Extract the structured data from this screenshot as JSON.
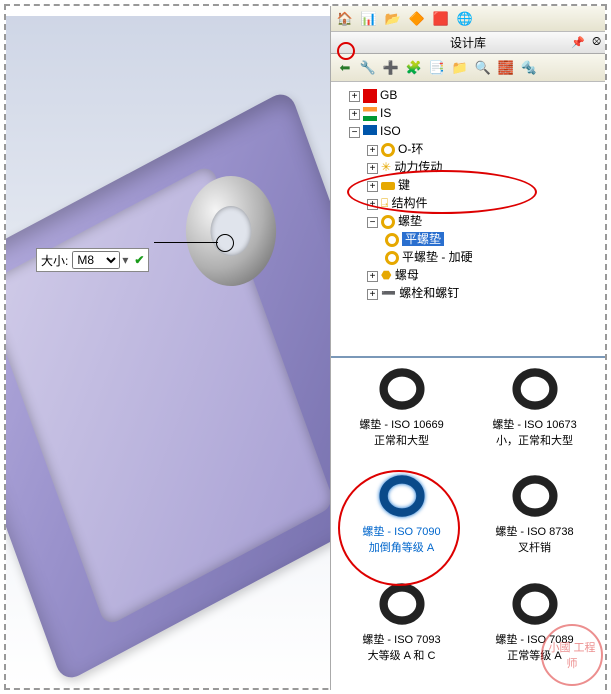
{
  "size_box": {
    "label": "大小:",
    "value": "M8"
  },
  "panel": {
    "title": "设计库",
    "main_toolbar_icons": [
      "home",
      "stats",
      "folder",
      "cube",
      "layers",
      "globe"
    ],
    "lib_toolbar_icons": [
      "back-arrow",
      "parts",
      "add-part",
      "tree-parts",
      "props",
      "folder",
      "search",
      "add",
      "screw"
    ]
  },
  "tree": {
    "gb": "GB",
    "is": "IS",
    "iso": "ISO",
    "iso_children": {
      "oring": "O-环",
      "power": "动力传动",
      "key": "键",
      "struct": "结构件",
      "washer": "螺垫",
      "flat_washer": "平螺垫",
      "flat_washer_hard": "平螺垫 - 加硬",
      "nut": "螺母",
      "bolt": "螺栓和螺钉"
    }
  },
  "thumbs": [
    {
      "id": "iso10669",
      "line1": "螺垫 - ISO 10669",
      "line2": "正常和大型"
    },
    {
      "id": "iso10673",
      "line1": "螺垫 - ISO 10673",
      "line2": "小，正常和大型"
    },
    {
      "id": "iso7090",
      "line1": "螺垫 - ISO 7090",
      "line2": "加倒角等级 A",
      "selected": true
    },
    {
      "id": "iso8738",
      "line1": "螺垫 - ISO 8738",
      "line2": "叉杆销"
    },
    {
      "id": "iso7093",
      "line1": "螺垫 - ISO 7093",
      "line2": "大等级 A 和 C"
    },
    {
      "id": "iso7089",
      "line1": "螺垫 - ISO 7089",
      "line2": "正常等级 A"
    }
  ],
  "watermark": "小國\n工程师"
}
